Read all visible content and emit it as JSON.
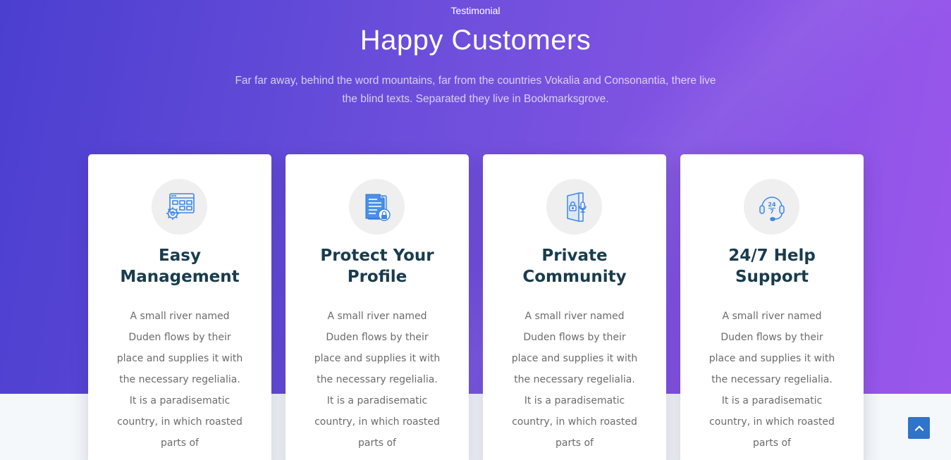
{
  "section": {
    "eyebrow": "Testimonial",
    "title": "Happy Customers",
    "intro": "Far far away, behind the word mountains, far from the countries Vokalia and Consonantia, there live the blind texts. Separated they live in Bookmarksgrove."
  },
  "cards": [
    {
      "icon": "browser-settings-icon",
      "title": "Easy Management",
      "text": "A small river named Duden flows by their place and supplies it with the necessary regelialia. It is a paradisematic country, in which roasted parts of"
    },
    {
      "icon": "document-lock-icon",
      "title": "Protect Your Profile",
      "text": "A small river named Duden flows by their place and supplies it with the necessary regelialia. It is a paradisematic country, in which roasted parts of"
    },
    {
      "icon": "door-microphone-lock-icon",
      "title": "Private Community",
      "text": "A small river named Duden flows by their place and supplies it with the necessary regelialia. It is a paradisematic country, in which roasted parts of"
    },
    {
      "icon": "support-headset-247-icon",
      "title": "24/7 Help Support",
      "text": "A small river named Duden flows by their place and supplies it with the necessary regelialia. It is a paradisematic country, in which roasted parts of"
    }
  ],
  "support_icon_text": {
    "top": "24",
    "bottom": "7"
  },
  "back_to_top": {
    "icon": "chevron-up-icon"
  },
  "colors": {
    "gradient_start": "#4b3fd0",
    "gradient_end": "#9b57ec",
    "card_title": "#193c4d",
    "icon_blue": "#3f86e6",
    "button_blue": "#2f74c9"
  }
}
